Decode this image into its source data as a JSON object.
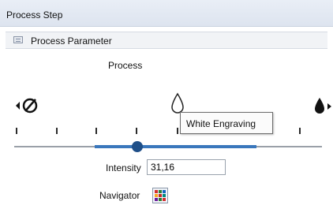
{
  "window": {
    "title": "Process Step"
  },
  "section": {
    "title": "Process Parameter",
    "icon": "parameter-grid-icon"
  },
  "process": {
    "label": "Process",
    "options": [
      {
        "name": "no-process-icon"
      },
      {
        "name": "light-drop-icon"
      },
      {
        "name": "dark-drop-icon"
      }
    ],
    "tooltip": "White Engraving"
  },
  "intensity": {
    "label": "Intensity",
    "value": "31,16"
  },
  "navigator": {
    "label": "Navigator",
    "icon": "navigator-color-grid-icon"
  },
  "colors": {
    "accent": "#3a77bc",
    "thumb": "#1f4f88",
    "header_bg": "#e3e9f2"
  }
}
